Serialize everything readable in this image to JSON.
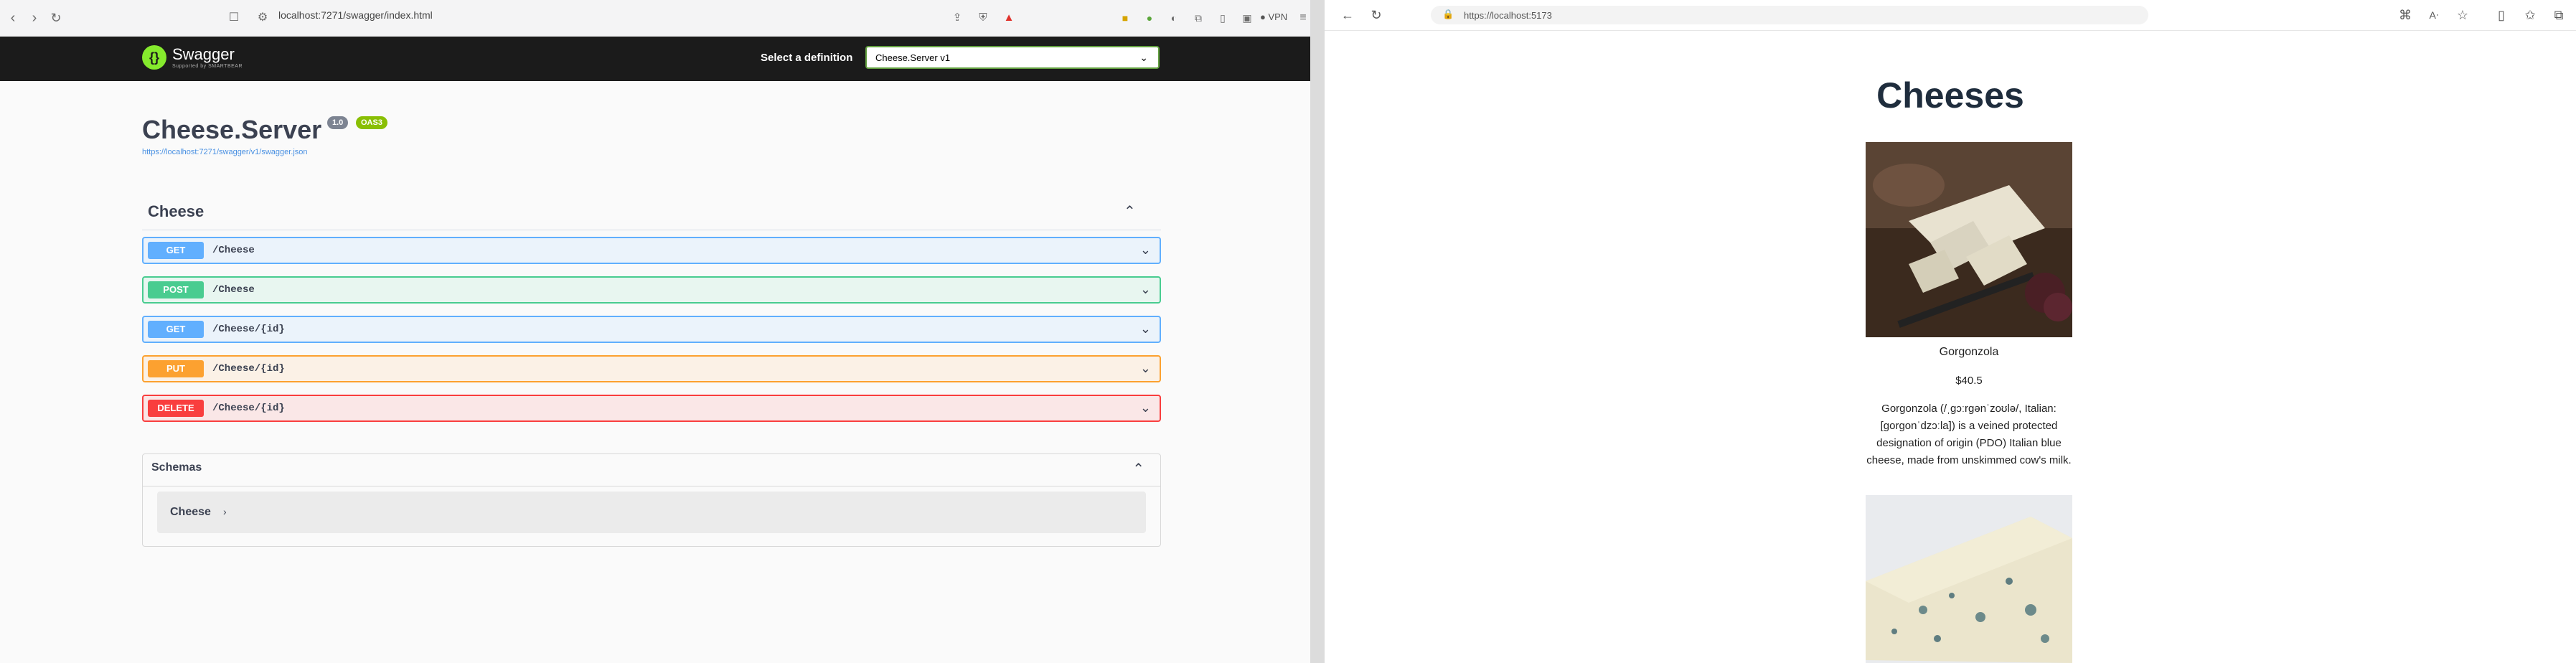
{
  "left_browser": {
    "url": "localhost:7271/swagger/index.html",
    "vpn_label": "VPN"
  },
  "swagger": {
    "logo_text": "Swagger",
    "logo_sub": "Supported by SMARTBEAR",
    "select_definition_label": "Select a definition",
    "selected_definition": "Cheese.Server v1",
    "title": "Cheese.Server",
    "version_badge": "1.0",
    "oas_badge": "OAS3",
    "spec_link": "https://localhost:7271/swagger/v1/swagger.json",
    "tag": "Cheese",
    "operations": [
      {
        "method": "GET",
        "path": "/Cheese",
        "color": "#61affe",
        "bg": "#ebf3fb"
      },
      {
        "method": "POST",
        "path": "/Cheese",
        "color": "#49cc90",
        "bg": "#e8f6f0"
      },
      {
        "method": "GET",
        "path": "/Cheese/{id}",
        "color": "#61affe",
        "bg": "#ebf3fb"
      },
      {
        "method": "PUT",
        "path": "/Cheese/{id}",
        "color": "#fca130",
        "bg": "#fbf1e6"
      },
      {
        "method": "DELETE",
        "path": "/Cheese/{id}",
        "color": "#f93e3e",
        "bg": "#fae7e7"
      }
    ],
    "schemas_title": "Schemas",
    "schema_models": [
      "Cheese"
    ]
  },
  "right_browser": {
    "url": "https://localhost:5173",
    "page_title": "Cheeses",
    "cheeses": [
      {
        "name": "Gorgonzola",
        "price": "$40.5",
        "description": "Gorgonzola (/ˌɡɔːrɡənˈzoʊlə/, Italian: [ɡorɡonˈdzɔːla]) is a veined protected designation of origin (PDO) Italian blue cheese, made from unskimmed cow's milk."
      }
    ]
  },
  "colors": {
    "swagger_header": "#1b1b1b",
    "swagger_green": "#85ea2d",
    "version_badge": "#7d8492",
    "oas_badge": "#89bf04"
  }
}
